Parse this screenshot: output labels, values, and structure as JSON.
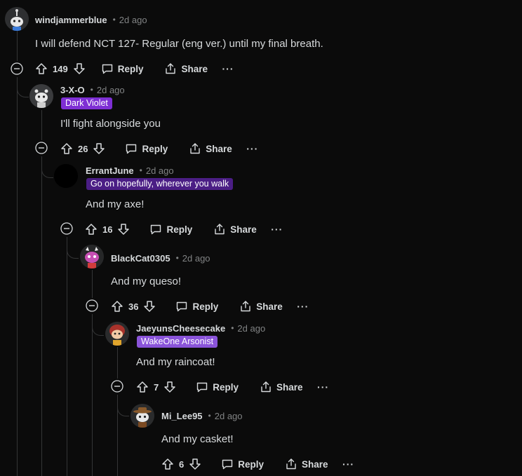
{
  "colors": {
    "background": "#0b0b0b",
    "thread_line": "#343536",
    "text": "#d7dadc",
    "muted": "#818384",
    "flair_purple": "#7e2fd4",
    "flair_dark_purple": "#4b1e85",
    "flair_light_purple": "#8a54d9"
  },
  "labels": {
    "reply": "Reply",
    "share": "Share",
    "more": "···",
    "separator": "•"
  },
  "comments": [
    {
      "author": "windjammerblue",
      "time": "2d ago",
      "body": "I will defend NCT 127- Regular (eng ver.) until my final breath.",
      "votes": "149",
      "flair": "",
      "avatar_icon": "snoo-avatar-icon"
    },
    {
      "author": "3-X-O",
      "time": "2d ago",
      "body": "I'll fight alongside you",
      "votes": "26",
      "flair": "Dark Violet",
      "avatar_icon": "snoo-avatar-icon"
    },
    {
      "author": "ErrantJune",
      "time": "2d ago",
      "body": "And my axe!",
      "votes": "16",
      "flair": "Go on hopefully, wherever you walk",
      "avatar_icon": "blank-avatar-icon"
    },
    {
      "author": "BlackCat0305",
      "time": "2d ago",
      "body": "And my queso!",
      "votes": "36",
      "flair": "",
      "avatar_icon": "pink-snoo-avatar-icon"
    },
    {
      "author": "JaeyunsCheesecake",
      "time": "2d ago",
      "body": "And my raincoat!",
      "votes": "7",
      "flair": "WakeOne Arsonist",
      "avatar_icon": "red-snoo-avatar-icon"
    },
    {
      "author": "Mi_Lee95",
      "time": "2d ago",
      "body": "And my casket!",
      "votes": "6",
      "flair": "",
      "avatar_icon": "cowboy-snoo-avatar-icon"
    }
  ]
}
